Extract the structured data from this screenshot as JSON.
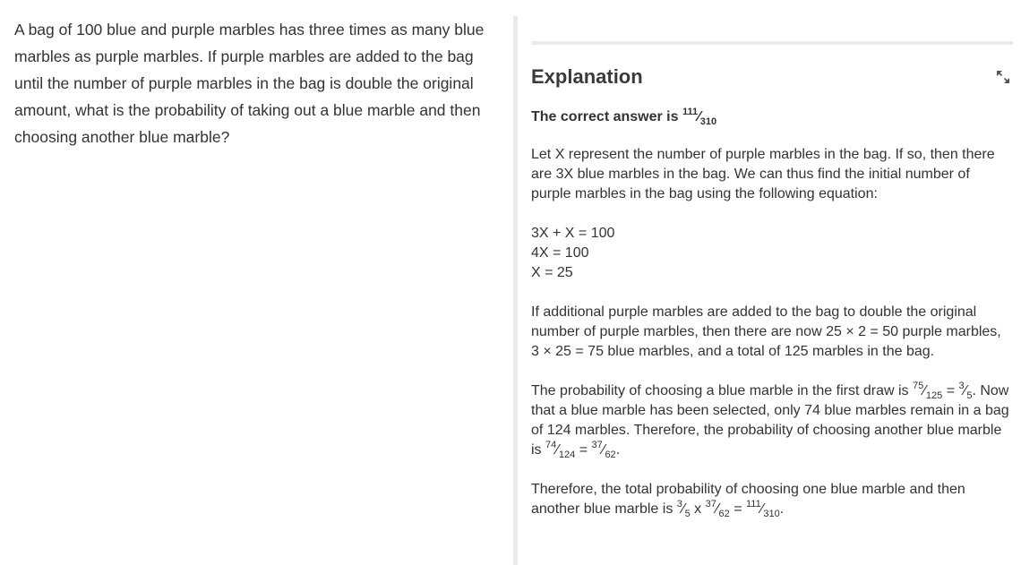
{
  "question": {
    "text": "A bag of 100 blue and purple marbles has three times as many blue marbles as purple marbles. If purple marbles are added to the bag until the number of purple marbles in the bag is double the original amount, what is the probability of taking out a blue marble and then choosing another blue marble?"
  },
  "explanation": {
    "title": "Explanation",
    "expand_icon": "expand-icon",
    "answer_prefix": "The correct answer is ",
    "answer_fraction": {
      "num": "111",
      "den": "310"
    },
    "para1": "Let X represent the number of purple marbles in the bag. If so, then there are 3X blue marbles in the bag. We can thus find the initial number of purple marbles in the bag using the following equation:",
    "equations": [
      "3X + X = 100",
      "4X = 100",
      "X = 25"
    ],
    "para2": "If additional purple marbles are added to the bag to double the original number of purple marbles, then there are now 25 × 2 = 50 purple marbles, 3 × 25 = 75 blue marbles, and a total of 125 marbles in the bag.",
    "para3": {
      "t1": "The probability of choosing a blue marble in the first draw is ",
      "f1": {
        "num": "75",
        "den": "125"
      },
      "t2": " = ",
      "f2": {
        "num": "3",
        "den": "5"
      },
      "t3": ". Now that a blue marble has been selected, only 74 blue marbles remain in a bag of 124 marbles. Therefore, the probability of choosing another blue marble is ",
      "f3": {
        "num": "74",
        "den": "124"
      },
      "t4": " = ",
      "f4": {
        "num": "37",
        "den": "62"
      },
      "t5": "."
    },
    "para4": {
      "t1": "Therefore, the total probability of choosing one blue marble and then another blue marble is ",
      "f1": {
        "num": "3",
        "den": "5"
      },
      "t2": " x ",
      "f2": {
        "num": "37",
        "den": "62"
      },
      "t3": " = ",
      "f3": {
        "num": "111",
        "den": "310"
      },
      "t4": "."
    }
  }
}
